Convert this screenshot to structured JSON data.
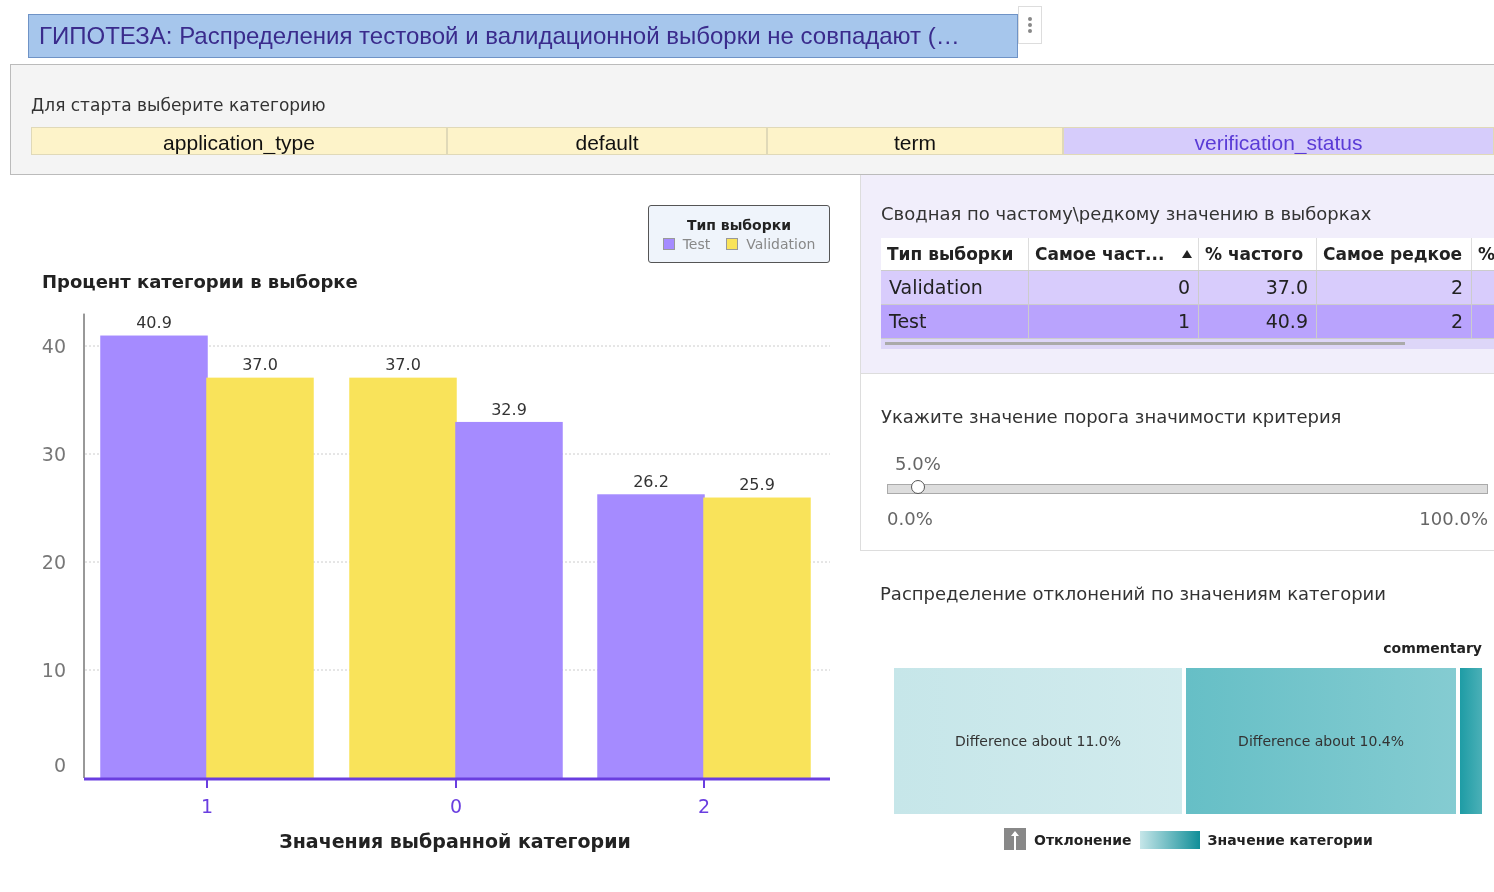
{
  "title": "ГИПОТЕЗА: Распределения тестовой и валидационной выборки не совпадают (…",
  "category_picker": {
    "label": "Для старта выберите категорию",
    "options": [
      {
        "label": "application_type",
        "selected": false
      },
      {
        "label": "default",
        "selected": false
      },
      {
        "label": "term",
        "selected": false
      },
      {
        "label": "verification_status",
        "selected": true
      }
    ]
  },
  "bar_chart": {
    "legend_title": "Тип выборки",
    "chart_data": {
      "type": "bar",
      "title": "Процент категории в выборке",
      "xlabel": "Значения выбранной категории",
      "categories": [
        "1",
        "0",
        "2"
      ],
      "series": [
        {
          "name": "Test",
          "color": "#a58bff",
          "values": [
            40.9,
            32.9,
            26.2
          ],
          "value_labels": [
            "40.9",
            "32.9",
            "26.2"
          ]
        },
        {
          "name": "Validation",
          "color": "#f9e35a",
          "values": [
            37.0,
            37.0,
            25.9
          ],
          "value_labels": [
            "37.0",
            "37.0",
            "25.9"
          ]
        }
      ],
      "ylim": [
        0,
        43
      ],
      "yticks": [
        0,
        10,
        20,
        30,
        40
      ],
      "grid": true
    }
  },
  "summary": {
    "title": "Сводная по частому\\редкому значению в выборках",
    "columns": [
      {
        "label": "Тип выборки"
      },
      {
        "label": "Самое част...",
        "sorted": true
      },
      {
        "label": "% частого"
      },
      {
        "label": "Самое редкое"
      },
      {
        "label": "%"
      }
    ],
    "rows": [
      {
        "cells": [
          "Validation",
          "0",
          "37.0",
          "2"
        ],
        "selected": false
      },
      {
        "cells": [
          "Test",
          "1",
          "40.9",
          "2"
        ],
        "selected": true
      }
    ]
  },
  "threshold": {
    "title": "Укажите значение порога значимости критерия",
    "value": "5.0%",
    "level": 0.05,
    "min": "0.0%",
    "max": "100.0%"
  },
  "deviation": {
    "title": "Распределение отклонений по значениям категории",
    "header": "commentary",
    "blocks": [
      {
        "label": "Difference about 11.0%",
        "color": "#c6e6e9"
      },
      {
        "label": "Difference about 10.4%",
        "color": "#66bfc6"
      },
      {
        "color": "#1e9ca5"
      }
    ],
    "legend_size": "Отклонение",
    "legend_color": "Значение категории"
  }
}
